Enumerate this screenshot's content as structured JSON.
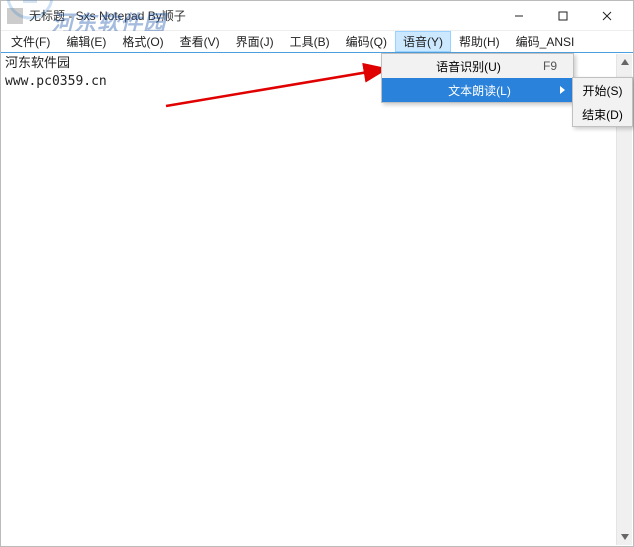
{
  "window": {
    "title": "无标题 - Sxs Notepad  By顺子"
  },
  "menubar": {
    "items": [
      {
        "label": "文件(F)"
      },
      {
        "label": "编辑(E)"
      },
      {
        "label": "格式(O)"
      },
      {
        "label": "查看(V)"
      },
      {
        "label": "界面(J)"
      },
      {
        "label": "工具(B)"
      },
      {
        "label": "编码(Q)"
      },
      {
        "label": "语音(Y)"
      },
      {
        "label": "帮助(H)"
      },
      {
        "label": "编码_ANSI"
      }
    ],
    "open_index": 7
  },
  "dropdown": {
    "items": [
      {
        "label": "语音识别(U)",
        "shortcut": "F9",
        "submenu": false
      },
      {
        "label": "文本朗读(L)",
        "shortcut": "",
        "submenu": true
      }
    ],
    "highlight_index": 1
  },
  "submenu": {
    "items": [
      {
        "label": "开始(S)"
      },
      {
        "label": "结束(D)"
      }
    ]
  },
  "editor": {
    "lines": [
      "河东软件园",
      "www.pc0359.cn"
    ]
  },
  "watermark": {
    "brand": "河东软件园",
    "url": "www.pc0359.cn"
  }
}
